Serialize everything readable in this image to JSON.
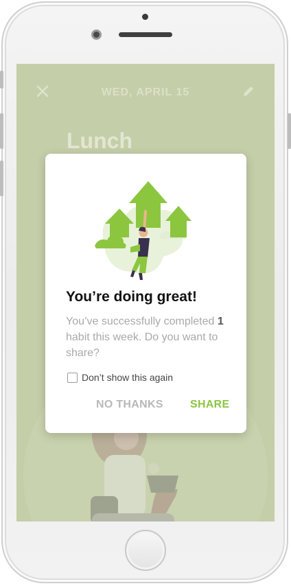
{
  "screen": {
    "date": "WED,  APRIL 15",
    "title": "Lunch",
    "icons": {
      "close": "close-icon",
      "edit": "pencil-icon"
    }
  },
  "dialog": {
    "title": "You’re doing great!",
    "body_prefix": "You’ve successfully completed ",
    "body_count": "1",
    "body_suffix": " habit this week. Do you want to share?",
    "checkbox_label": "Don’t show this again",
    "checkbox_checked": false,
    "no_thanks_label": "NO THANKS",
    "share_label": "SHARE"
  },
  "colors": {
    "accent": "#8cc63f",
    "overlay_bg": "#c4cea8",
    "muted_text": "#a9a9a9"
  }
}
